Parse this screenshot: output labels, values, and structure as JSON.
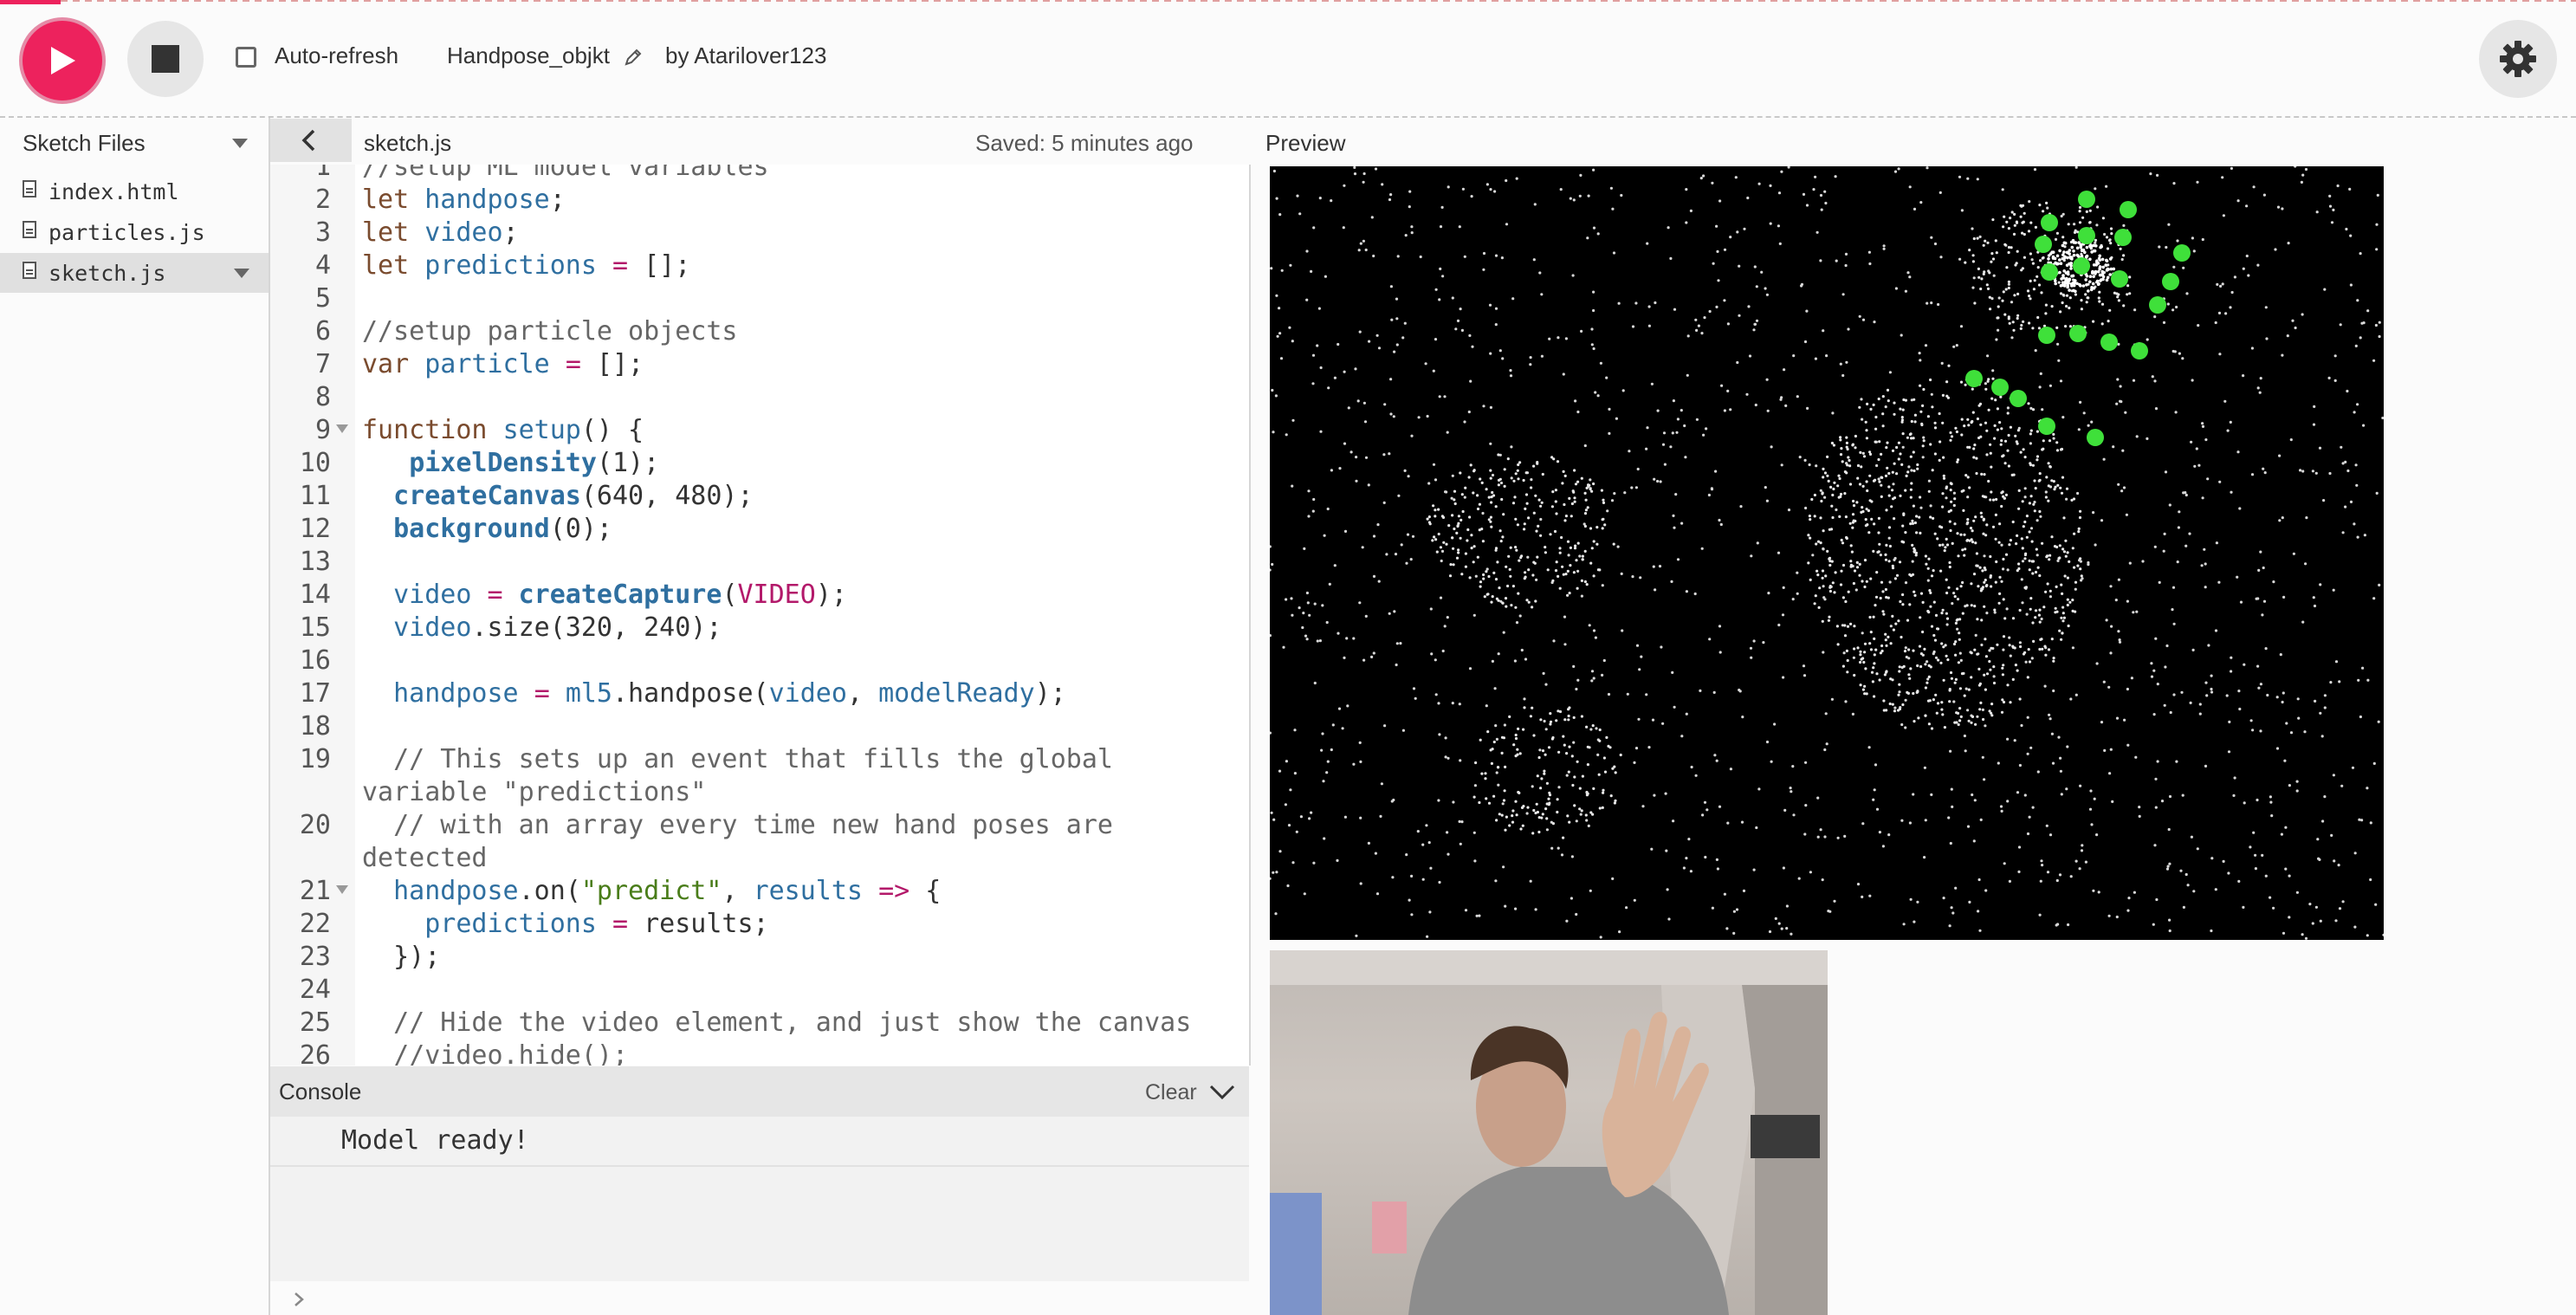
{
  "toolbar": {
    "auto_refresh_label": "Auto-refresh",
    "auto_refresh_checked": false,
    "sketch_name": "Handpose_objkt",
    "author": "by Atarilover123"
  },
  "sidebar": {
    "title": "Sketch Files",
    "files": [
      {
        "name": "index.html",
        "active": false
      },
      {
        "name": "particles.js",
        "active": false
      },
      {
        "name": "sketch.js",
        "active": true
      }
    ]
  },
  "editor": {
    "filename": "sketch.js",
    "saved_status": "Saved: 5 minutes ago",
    "line_numbers": [
      "1",
      "2",
      "3",
      "4",
      "5",
      "6",
      "7",
      "8",
      "9",
      "10",
      "11",
      "12",
      "13",
      "14",
      "15",
      "16",
      "17",
      "18",
      "19",
      "",
      "20",
      "",
      "21",
      "22",
      "23",
      "24",
      "25",
      "26"
    ]
  },
  "preview": {
    "label": "Preview"
  },
  "console": {
    "title": "Console",
    "clear_label": "Clear",
    "messages": [
      "Model ready!"
    ]
  }
}
